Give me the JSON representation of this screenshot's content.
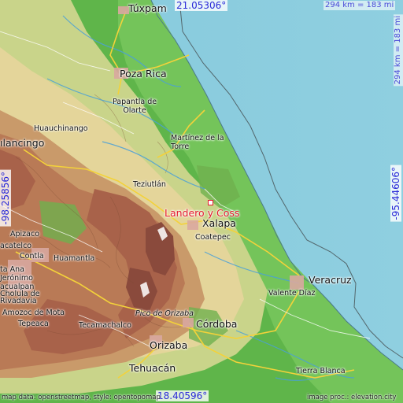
{
  "coordinates": {
    "top_lat": "21.05306°",
    "bottom_lat": "18.40596°",
    "left_lon": "-98.25856°",
    "right_lon": "-95.44606°"
  },
  "scale": {
    "horizontal": "294 km = 183 mi",
    "vertical": "294 km = 183 mi"
  },
  "highlight_place": "Landero y Coss",
  "places": {
    "tuxpam": "Túxpam",
    "poza_rica": "Poza Rica",
    "papantla": "Papantla de\nOlarte",
    "huauchinango": "Huauchinango",
    "tulancingo": "ılancingo",
    "martinez": "Martínez de la\nTorre",
    "teziutlan": "Teziutlán",
    "xalapa": "Xalapa",
    "coatepec": "Coatepec",
    "apizaco": "Apizaco",
    "contla": "Contla",
    "huamantla": "Huamantla",
    "zacatelco": "acatelco",
    "san_jeronimo": "Jerónimo\nacualpan",
    "santa_ana": "ta Ana",
    "rivadavia": "Rivadavia",
    "cholula": "Cholula de",
    "amozoc": "Amozoc de Mota",
    "tepeaca": "Tepeaca",
    "tecamachalco": "Tecamachalco",
    "pico": "Pico de Orizaba",
    "cordoba": "Córdoba",
    "orizaba": "Orizaba",
    "veracruz": "Veracruz",
    "valente": "Valente Díaz",
    "tehuacan": "Tehuacán",
    "tierra_blanca": "Tierra Blanca"
  },
  "credits": {
    "left": "map data: openstreetmap, style: opentopomap",
    "right": "image proc.: elevation.city"
  }
}
